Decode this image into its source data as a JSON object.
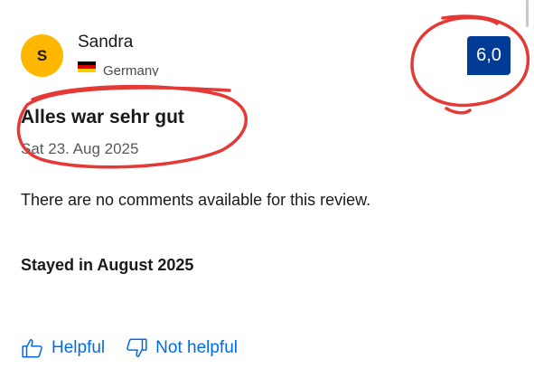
{
  "reviewer": {
    "avatar_initial": "S",
    "name": "Sandra",
    "country": "Germany"
  },
  "score": "6,0",
  "review": {
    "title": "Alles war sehr gut",
    "date": "Sat 23. Aug 2025",
    "comment": "There are no comments available for this review.",
    "stay": "Stayed in August 2025"
  },
  "feedback": {
    "helpful_label": "Helpful",
    "not_helpful_label": "Not helpful"
  },
  "colors": {
    "avatar": "#ffb700",
    "score_badge": "#003b95",
    "link": "#006ce4",
    "annotation": "#e53935"
  },
  "icons": {
    "flag": "germany-flag-icon",
    "helpful": "thumbs-up-icon",
    "not_helpful": "thumbs-down-icon"
  }
}
